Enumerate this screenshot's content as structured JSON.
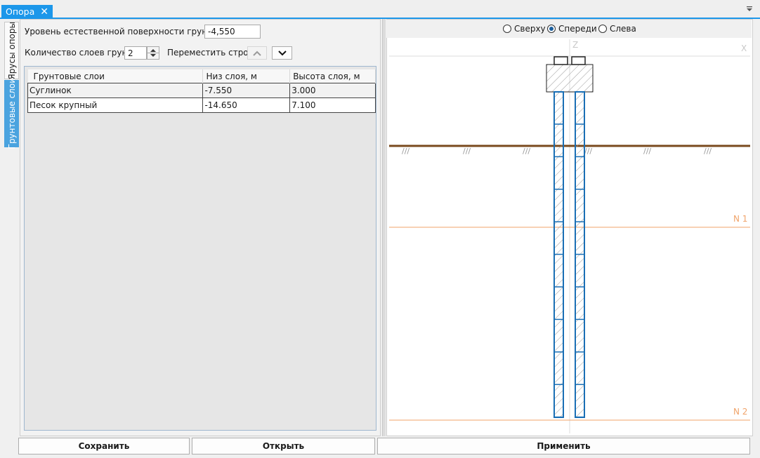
{
  "tab": {
    "title": "Опора",
    "close": "✕"
  },
  "side_tabs": {
    "tiers": "Ярусы опоры",
    "soil": "Грунтовые слои"
  },
  "form": {
    "ground_level_label": "Уровень естественной поверхности грунта, м",
    "ground_level_value": "-4,550",
    "layers_count_label": "Количество слоев грунта",
    "layers_count_value": "2",
    "move_row_label": "Переместить строку"
  },
  "table": {
    "headers": [
      "Грунтовые слои",
      "Низ слоя, м",
      "Высота слоя, м"
    ],
    "rows": [
      [
        "Суглинок",
        "-7.550",
        "3.000"
      ],
      [
        "Песок крупный",
        "-14.650",
        "7.100"
      ]
    ]
  },
  "view": {
    "options": [
      "Сверху",
      "Спереди",
      "Слева"
    ],
    "selected": "Спереди",
    "axis_z": "Z",
    "axis_x": "X",
    "levels": [
      "N 1",
      "N 2"
    ],
    "ground_hatch": "///"
  },
  "buttons": {
    "save": "Сохранить",
    "open": "Открыть",
    "apply": "Применить"
  },
  "colors": {
    "accent": "#1c97ea",
    "pile": "#1a6fb5",
    "ground": "#7a4a1e",
    "level_line": "#f0a36a"
  }
}
